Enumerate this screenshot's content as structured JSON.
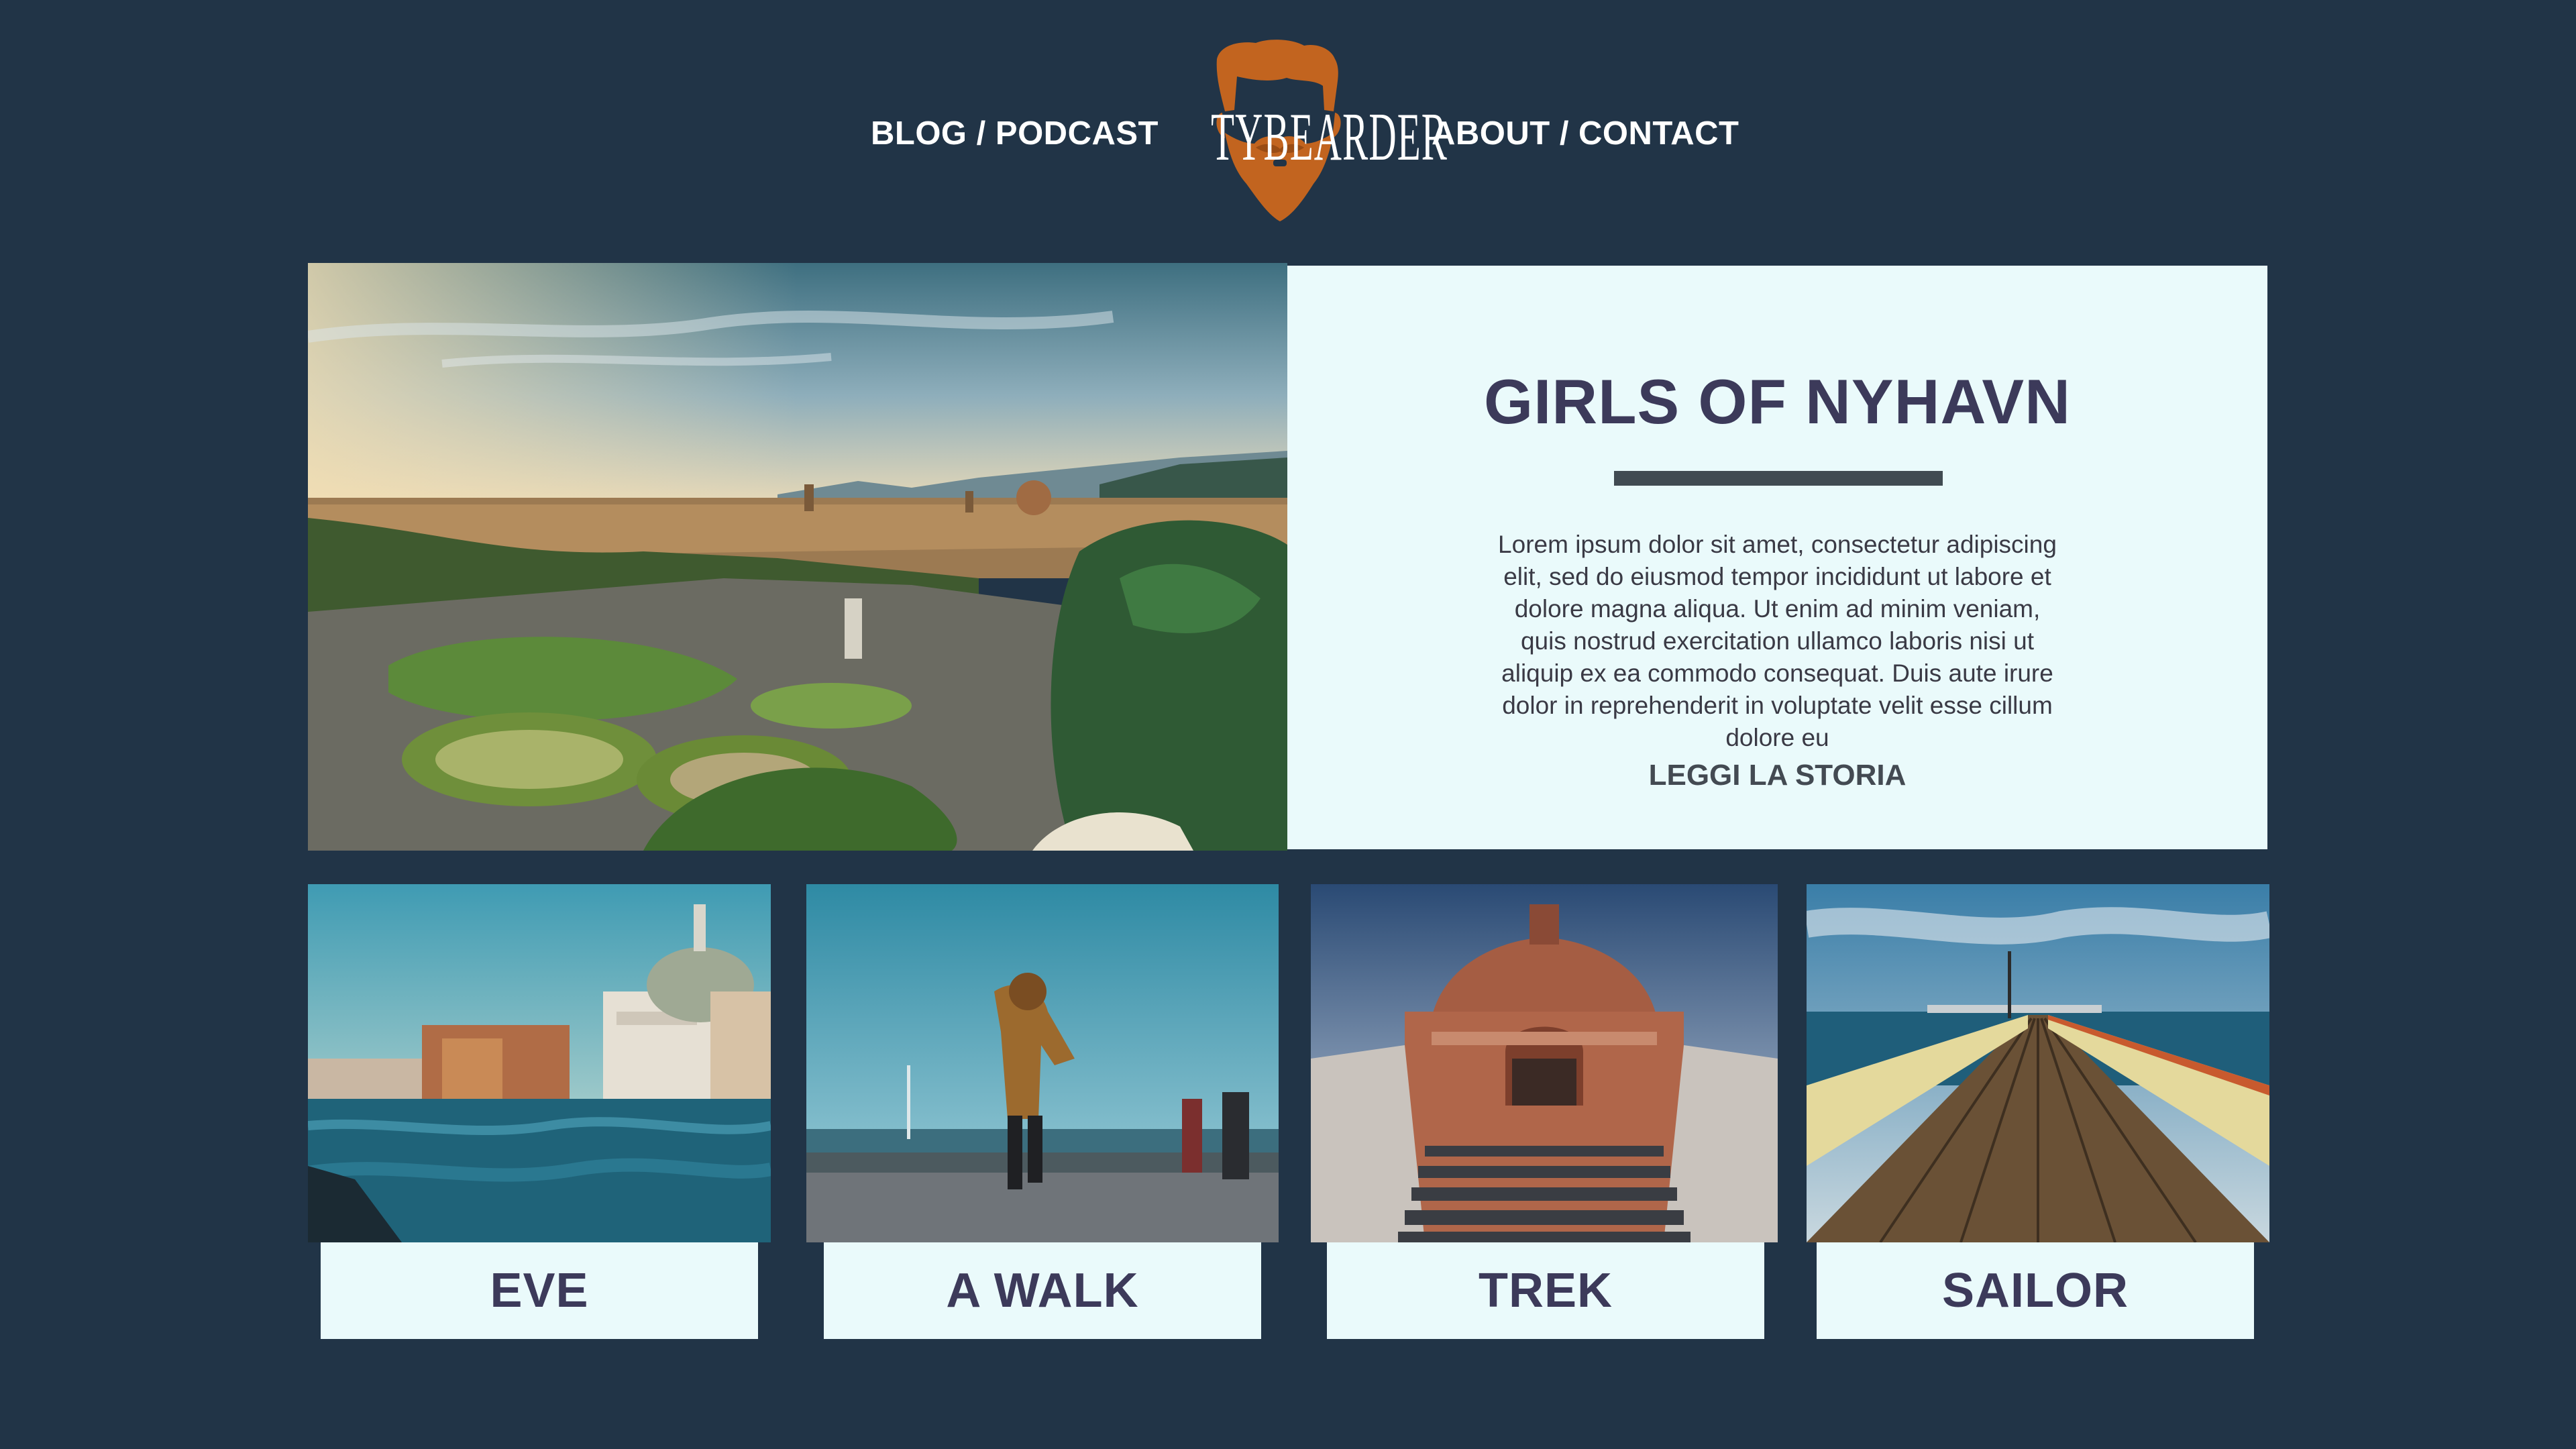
{
  "header": {
    "nav_left": "BLOG / PODCAST",
    "logo_text": "TYBEARDER",
    "nav_right": "ABOUT / CONTACT"
  },
  "featured": {
    "image_alt": "Panoramic view of Florence at sunset from a hilltop garden",
    "title": "GIRLS OF NYHAVN",
    "excerpt": "Lorem ipsum dolor sit amet, consectetur adipiscing elit, sed do eiusmod tempor incididunt ut labore et dolore magna aliqua. Ut enim ad minim veniam, quis nostrud exercitation ullamco laboris nisi ut aliquip ex ea commodo consequat. Duis aute irure dolor in reprehenderit in voluptate velit esse cillum dolore eu",
    "cta": "LEGGI LA STORIA"
  },
  "posts": [
    {
      "label": "EVE",
      "image_alt": "Venice canal with domed church"
    },
    {
      "label": "A WALK",
      "image_alt": "Child walking on a seaside promenade"
    },
    {
      "label": "TREK",
      "image_alt": "Brick sanctuary with stone staircase"
    },
    {
      "label": "SAILOR",
      "image_alt": "Wooden pier stretching into the sea"
    }
  ],
  "colors": {
    "background": "#213447",
    "card": "#eafafb",
    "title": "#3c3a5a",
    "logo_accent": "#c2641f"
  }
}
